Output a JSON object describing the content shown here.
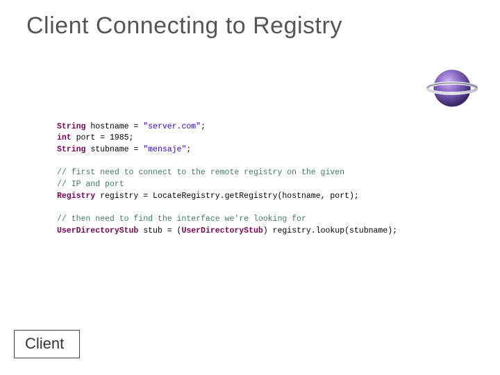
{
  "title": "Client Connecting to Registry",
  "client_label": "Client",
  "logo_name": "eclipse-logo",
  "code": {
    "l1": {
      "kw": "String",
      "name": " hostname = ",
      "val": "\"server.com\"",
      "end": ";"
    },
    "l2": {
      "kw": "int",
      "name": " port = ",
      "val": "1985",
      "end": ";"
    },
    "l3": {
      "kw": "String",
      "name": " stubname = ",
      "val": "\"mensaje\"",
      "end": ";"
    },
    "cmt1a": "// first need to connect to the remote registry on the given",
    "cmt1b": "// IP and port",
    "l4": {
      "kw": "Registry",
      "name": " registry = ",
      "call": "LocateRegistry.getRegistry",
      "args": "(hostname, port);"
    },
    "cmt2": "// then need to find the interface we're looking for",
    "l5": {
      "kw": "UserDirectoryStub",
      "name": " stub = (",
      "cast": "UserDirectoryStub",
      "rest": ") registry.lookup(stubname);"
    }
  }
}
